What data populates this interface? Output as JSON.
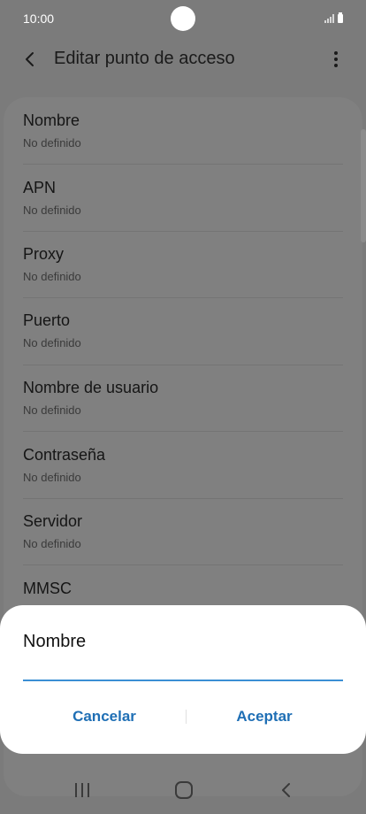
{
  "status_bar": {
    "time": "10:00",
    "icons": [
      "camera-hole",
      "signal-icon",
      "battery-icon"
    ]
  },
  "app_bar": {
    "back_icon": "back-arrow-icon",
    "title": "Editar punto de acceso",
    "more_icon": "more-vertical-icon"
  },
  "settings": {
    "items": [
      {
        "title": "Nombre",
        "value": "No definido"
      },
      {
        "title": "APN",
        "value": "No definido"
      },
      {
        "title": "Proxy",
        "value": "No definido"
      },
      {
        "title": "Puerto",
        "value": "No definido"
      },
      {
        "title": "Nombre de usuario",
        "value": "No definido"
      },
      {
        "title": "Contraseña",
        "value": "No definido"
      },
      {
        "title": "Servidor",
        "value": "No definido"
      },
      {
        "title": "MMSC",
        "value": ""
      }
    ]
  },
  "dialog": {
    "title": "Nombre",
    "input_value": "",
    "cancel_label": "Cancelar",
    "accept_label": "Aceptar"
  },
  "nav_bar": {
    "icons": [
      "recent-apps-icon",
      "home-icon",
      "back-icon"
    ]
  },
  "colors": {
    "scrim": "#7b7b7b",
    "accent": "#1f6fb5",
    "input_underline": "#3b8fd4",
    "dialog_bg": "#ffffff"
  }
}
